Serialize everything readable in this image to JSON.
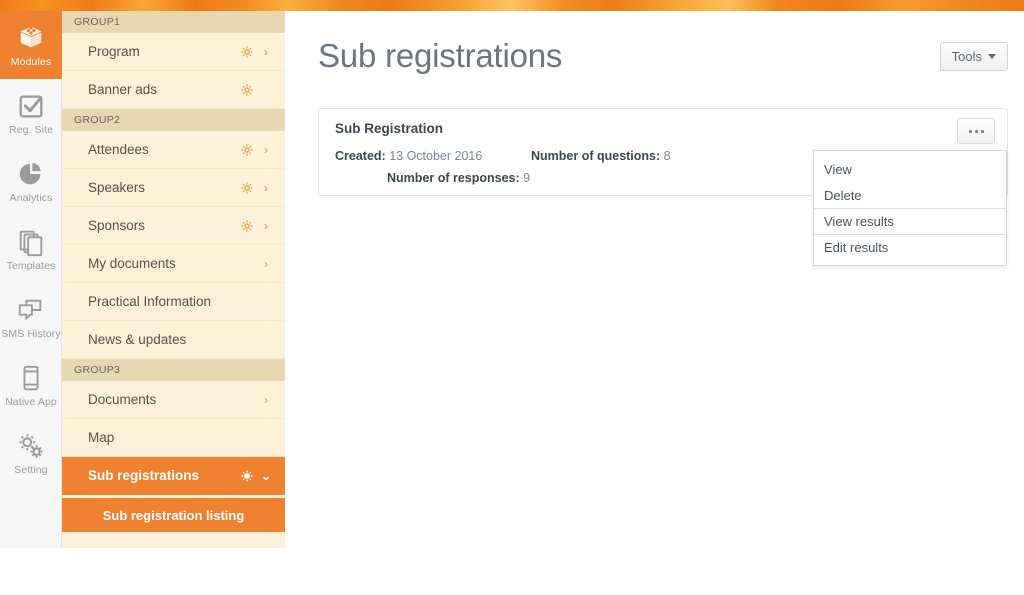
{
  "rail": {
    "items": [
      {
        "label": "Modules",
        "icon": "modules-icon",
        "active": true
      },
      {
        "label": "Reg. Site",
        "icon": "checkbox-icon",
        "active": false
      },
      {
        "label": "Analytics",
        "icon": "pie-chart-icon",
        "active": false
      },
      {
        "label": "Templates",
        "icon": "layers-icon",
        "active": false
      },
      {
        "label": "SMS History",
        "icon": "chat-bubble-icon",
        "active": false
      },
      {
        "label": "Native App",
        "icon": "mobile-icon",
        "active": false
      },
      {
        "label": "Setting",
        "icon": "gears-icon",
        "active": false
      }
    ]
  },
  "sidebar": {
    "groups": [
      {
        "label": "GROUP1",
        "items": [
          {
            "label": "Program",
            "gear": true,
            "caret": true,
            "active": false
          },
          {
            "label": "Banner ads",
            "gear": true,
            "caret": false,
            "active": false
          }
        ]
      },
      {
        "label": "GROUP2",
        "items": [
          {
            "label": "Attendees",
            "gear": true,
            "caret": true,
            "active": false
          },
          {
            "label": "Speakers",
            "gear": true,
            "caret": true,
            "active": false
          },
          {
            "label": "Sponsors",
            "gear": true,
            "caret": true,
            "active": false
          },
          {
            "label": "My documents",
            "gear": false,
            "caret": true,
            "active": false
          },
          {
            "label": "Practical Information",
            "gear": false,
            "caret": false,
            "active": false
          },
          {
            "label": "News & updates",
            "gear": false,
            "caret": false,
            "active": false
          }
        ]
      },
      {
        "label": "GROUP3",
        "items": [
          {
            "label": "Documents",
            "gear": false,
            "caret": true,
            "active": false
          },
          {
            "label": "Map",
            "gear": false,
            "caret": false,
            "active": false
          },
          {
            "label": "Sub registrations",
            "gear": true,
            "caret": true,
            "active": true,
            "caret_dir": "down"
          }
        ]
      }
    ],
    "subitem": {
      "label": "Sub registration listing",
      "active": true
    }
  },
  "main": {
    "title": "Sub registrations",
    "tools_button": {
      "label": "Tools",
      "icon": "caret-down-icon"
    },
    "card": {
      "title": "Sub Registration",
      "created_label": "Created:",
      "created_value": "13 October 2016",
      "questions_label": "Number of questions:",
      "questions_value": "8",
      "responses_label": "Number of responses:",
      "responses_value": "9",
      "menu_button_icon": "ellipsis-icon"
    },
    "dropdown": {
      "items": [
        {
          "label": "View",
          "separator": false
        },
        {
          "label": "Delete",
          "separator": false
        },
        {
          "label": "View results",
          "separator": true
        },
        {
          "label": "Edit results",
          "separator": true
        }
      ]
    }
  },
  "colors": {
    "accent_orange": "#ef8231",
    "sidebar_bg": "#fdf2d9",
    "group_bg": "#e8d7b3",
    "title_gray": "#6c757d"
  }
}
